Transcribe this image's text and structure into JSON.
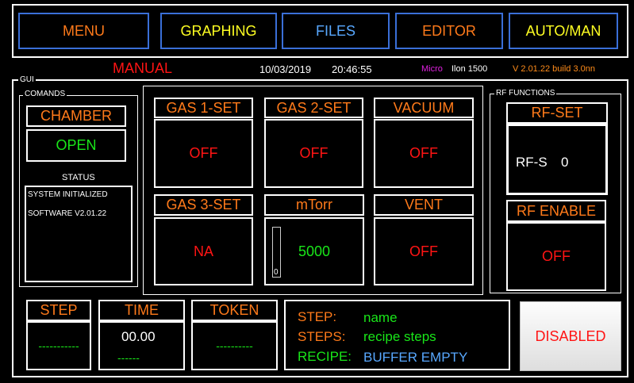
{
  "nav": {
    "menu": {
      "label": "MENU",
      "color": "#ff7a1a"
    },
    "graphing": {
      "label": "GRAPHING",
      "color": "#ffff22"
    },
    "files": {
      "label": "FILES",
      "color": "#58a8ff"
    },
    "editor": {
      "label": "EDITOR",
      "color": "#ff7a1a"
    },
    "automan": {
      "label": "AUTO/MAN",
      "color": "#ffff22"
    }
  },
  "status_bar": {
    "mode": "MANUAL",
    "date": "10/03/2019",
    "time": "20:46:55",
    "brand_micro": "Micro",
    "brand_model": "Ilon 1500",
    "version": "V 2.01.22 build 3.0nn"
  },
  "gui": {
    "group_label": "GUI",
    "commands": {
      "group_label": "COMANDS",
      "chamber_label": "CHAMBER",
      "chamber_button": "OPEN",
      "status_label": "STATUS",
      "status_lines": [
        "SYSTEM INITIALIZED",
        "SOFTWARE V2.01.22"
      ]
    },
    "gas1": {
      "label": "GAS 1-SET",
      "value": "OFF"
    },
    "gas2": {
      "label": "GAS 2-SET",
      "value": "OFF"
    },
    "vacuum": {
      "label": "VACUUM",
      "value": "OFF"
    },
    "gas3": {
      "label": "GAS 3-SET",
      "value": "NA"
    },
    "mtorr": {
      "label": "mTorr",
      "value": "5000",
      "bar_value": "0",
      "bar_level": 0
    },
    "vent": {
      "label": "VENT",
      "value": "OFF"
    },
    "rf": {
      "group_label": "RF FUNCTIONS",
      "set_label": "RF-SET",
      "set_prefix": "RF-S",
      "set_value": "0",
      "enable_label": "RF ENABLE",
      "enable_value": "OFF"
    }
  },
  "bottom": {
    "step": {
      "label": "STEP",
      "value": "-----------"
    },
    "time": {
      "label": "TIME",
      "value": "00.00",
      "sub": "------"
    },
    "token": {
      "label": "TOKEN",
      "value": "----------"
    },
    "info": {
      "step_label": "STEP:",
      "step_value": "name",
      "steps_label": "STEPS:",
      "steps_value": "recipe steps",
      "recipe_label": "RECIPE:",
      "recipe_value": "BUFFER EMPTY"
    },
    "disabled_button": "DISABLED"
  }
}
